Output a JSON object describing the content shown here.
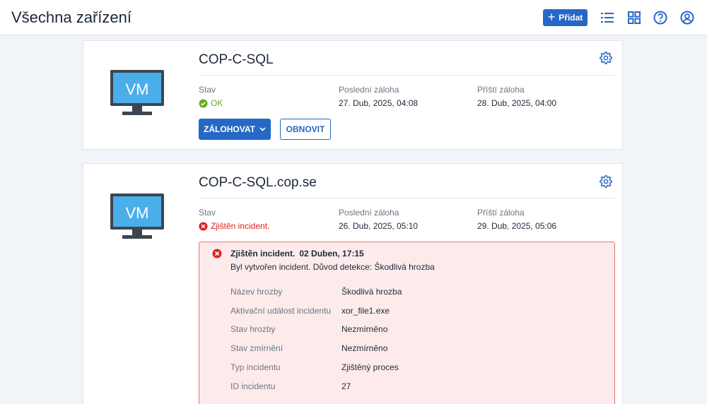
{
  "header": {
    "title": "Všechna zařízení",
    "add_label": "Přidat",
    "icons": [
      "list-view-icon",
      "grid-view-icon",
      "help-icon",
      "account-icon"
    ],
    "accent_color": "#2668c5"
  },
  "devices": [
    {
      "name": "COP-C-SQL",
      "type_label": "VM",
      "status_label": "Stav",
      "status": "OK",
      "status_color": "#6aaa1c",
      "last_backup_label": "Poslední záloha",
      "last_backup": "27. Dub, 2025, 04:08",
      "next_backup_label": "Příští záloha",
      "next_backup": "28. Dub, 2025, 04:00",
      "backup_button": "ZÁLOHOVAT",
      "restore_button": "OBNOVIT"
    },
    {
      "name": "COP-C-SQL.cop.se",
      "type_label": "VM",
      "status_label": "Stav",
      "status": "Zjištěn incident.",
      "status_color": "#e02121",
      "last_backup_label": "Poslední záloha",
      "last_backup": "26. Dub, 2025, 05:10",
      "next_backup_label": "Příští záloha",
      "next_backup": "29. Dub, 2025, 05:06",
      "incident": {
        "title": "Zjištěn incident.",
        "time": "02 Duben, 17:15",
        "description": "Byl vytvořen incident. Důvod detekce: Škodlivá hrozba",
        "details": [
          {
            "key": "Název hrozby",
            "value": "Škodlivá hrozba"
          },
          {
            "key": "Aktivační událost incidentu",
            "value": "xor_file1.exe"
          },
          {
            "key": "Stav hrozby",
            "value": "Nezmírněno"
          },
          {
            "key": "Stav zmírnění",
            "value": "Nezmírněno"
          },
          {
            "key": "Typ incidentu",
            "value": "Zjištěný proces"
          },
          {
            "key": "ID incidentu",
            "value": "27"
          }
        ]
      }
    }
  ]
}
